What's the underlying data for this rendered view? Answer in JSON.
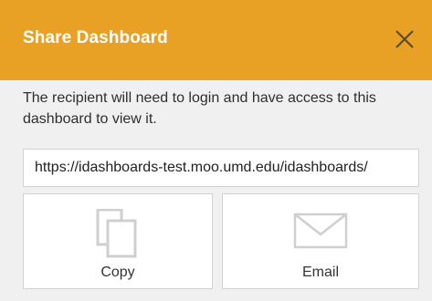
{
  "dialog": {
    "title": "Share Dashboard",
    "close_icon": "close-icon",
    "message": "The recipient will need to login and have access to this dashboard to view it.",
    "url_value": "https://idashboards-test.moo.umd.edu/idashboards/",
    "buttons": {
      "copy": {
        "label": "Copy",
        "icon": "copy-icon"
      },
      "email": {
        "label": "Email",
        "icon": "envelope-icon"
      }
    }
  },
  "colors": {
    "header_background": "#e8a124",
    "header_text": "#ffffff",
    "body_background": "#f0f0f0",
    "icon_gray": "#cfcfcf"
  }
}
